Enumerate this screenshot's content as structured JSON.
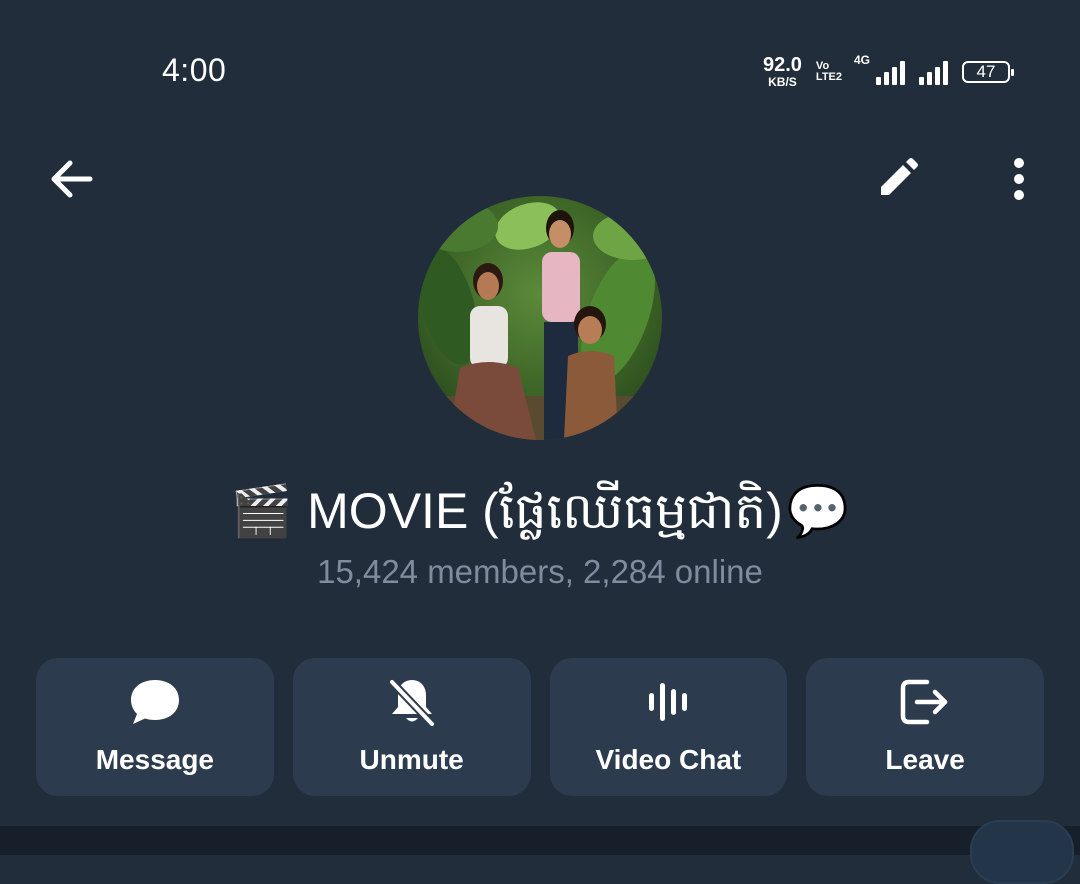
{
  "status_bar": {
    "time": "4:00",
    "net_speed_value": "92.0",
    "net_speed_unit": "KB/S",
    "volte_top": "Vo",
    "volte_bottom": "LTE2",
    "network_type": "4G",
    "battery": "47"
  },
  "header": {
    "back_icon": "arrow-left-icon",
    "edit_icon": "pencil-icon",
    "more_icon": "more-vertical-icon"
  },
  "profile": {
    "title_prefix_emoji": "🎬",
    "title": "MOVIE (ផ្លែឈើធម្មជាតិ)",
    "title_suffix_emoji": "💬",
    "members_text": "15,424 members, 2,284 online"
  },
  "actions": [
    {
      "label": "Message",
      "icon": "chat-bubble-icon"
    },
    {
      "label": "Unmute",
      "icon": "bell-off-icon"
    },
    {
      "label": "Video Chat",
      "icon": "voice-bars-icon"
    },
    {
      "label": "Leave",
      "icon": "exit-icon"
    }
  ],
  "colors": {
    "background": "#212d3b",
    "button_bg": "#2d3b4e",
    "secondary_text": "#7f8c9c"
  }
}
